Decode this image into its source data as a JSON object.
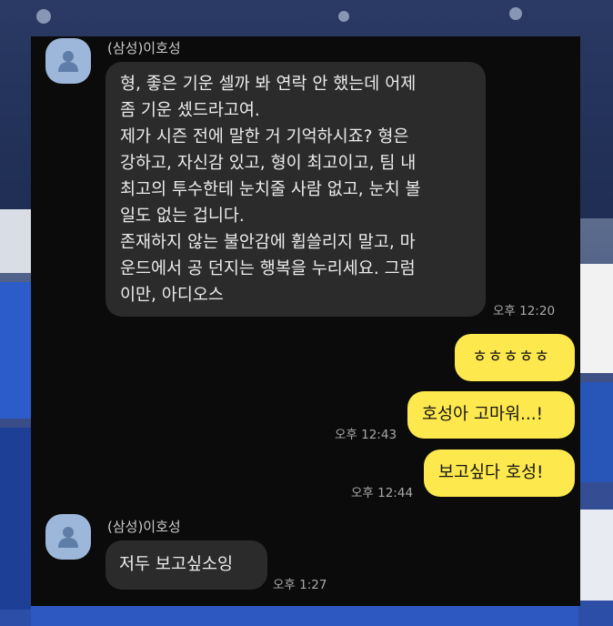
{
  "chat": {
    "messages": [
      {
        "sender": "(삼성)이호성",
        "lines": [
          "형, 좋은 기운 셀까 봐 연락 안 했는데 어제",
          "좀 기운 셌드라고여.",
          "제가 시즌 전에 말한 거 기억하시죠? 형은",
          "강하고, 자신감 있고, 형이 최고이고, 팀 내",
          "최고의 투수한테 눈치줄 사람 없고, 눈치 볼",
          "일도 없는 겁니다.",
          "존재하지 않는 불안감에 휩쓸리지 말고, 마",
          "운드에서 공 던지는 행복을 누리세요. 그럼",
          "이만, 아디오스"
        ],
        "time": "오후 12:20"
      },
      {
        "text": "ㅎㅎㅎㅎㅎ",
        "time": ""
      },
      {
        "text": "호성아 고마워...!",
        "time": "오후 12:43"
      },
      {
        "text": "보고싶다 호성!",
        "time": "오후 12:44"
      },
      {
        "sender": "(삼성)이호성",
        "text": "저두 보고싶소잉",
        "time": "오후 1:27"
      }
    ]
  },
  "colors": {
    "panel_bg": "#0b0b0b",
    "incoming_bubble": "#2b2b2b",
    "outgoing_bubble": "#fde84d",
    "avatar_bg": "#9cb7d9"
  },
  "icons": {
    "avatar": "person-icon"
  }
}
